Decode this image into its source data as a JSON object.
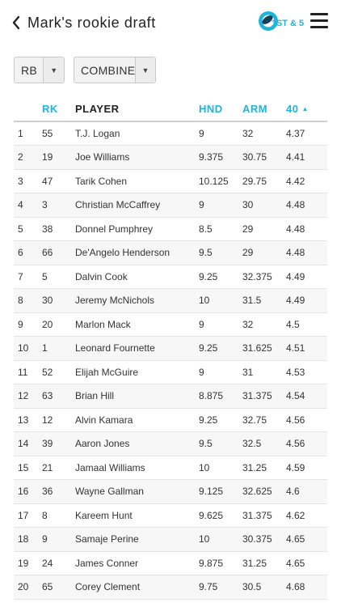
{
  "header": {
    "title": "Mark's rookie draft",
    "logo_text": "1ST & 5",
    "colors": {
      "accent": "#1fb4dc",
      "logo_dark": "#1a3d5c"
    }
  },
  "filters": {
    "position": {
      "value": "RB"
    },
    "stat": {
      "value": "COMBINE"
    }
  },
  "table": {
    "columns": {
      "index": "",
      "rank": "RK",
      "player": "PLAYER",
      "hand": "HND",
      "arm": "ARM",
      "forty": "40"
    },
    "sort_column": "forty",
    "sort_direction": "ascending",
    "rows": [
      {
        "index": "1",
        "rank": "55",
        "player": "T.J. Logan",
        "hand": "9",
        "arm": "32",
        "forty": "4.37"
      },
      {
        "index": "2",
        "rank": "19",
        "player": "Joe Williams",
        "hand": "9.375",
        "arm": "30.75",
        "forty": "4.41"
      },
      {
        "index": "3",
        "rank": "47",
        "player": "Tarik Cohen",
        "hand": "10.125",
        "arm": "29.75",
        "forty": "4.42"
      },
      {
        "index": "4",
        "rank": "3",
        "player": "Christian McCaffrey",
        "hand": "9",
        "arm": "30",
        "forty": "4.48"
      },
      {
        "index": "5",
        "rank": "38",
        "player": "Donnel Pumphrey",
        "hand": "8.5",
        "arm": "29",
        "forty": "4.48"
      },
      {
        "index": "6",
        "rank": "66",
        "player": "De'Angelo Henderson",
        "hand": "9.5",
        "arm": "29",
        "forty": "4.48"
      },
      {
        "index": "7",
        "rank": "5",
        "player": "Dalvin Cook",
        "hand": "9.25",
        "arm": "32.375",
        "forty": "4.49"
      },
      {
        "index": "8",
        "rank": "30",
        "player": "Jeremy McNichols",
        "hand": "10",
        "arm": "31.5",
        "forty": "4.49"
      },
      {
        "index": "9",
        "rank": "20",
        "player": "Marlon Mack",
        "hand": "9",
        "arm": "32",
        "forty": "4.5"
      },
      {
        "index": "10",
        "rank": "1",
        "player": "Leonard Fournette",
        "hand": "9.25",
        "arm": "31.625",
        "forty": "4.51"
      },
      {
        "index": "11",
        "rank": "52",
        "player": "Elijah McGuire",
        "hand": "9",
        "arm": "31",
        "forty": "4.53"
      },
      {
        "index": "12",
        "rank": "63",
        "player": "Brian Hill",
        "hand": "8.875",
        "arm": "31.375",
        "forty": "4.54"
      },
      {
        "index": "13",
        "rank": "12",
        "player": "Alvin Kamara",
        "hand": "9.25",
        "arm": "32.75",
        "forty": "4.56"
      },
      {
        "index": "14",
        "rank": "39",
        "player": "Aaron Jones",
        "hand": "9.5",
        "arm": "32.5",
        "forty": "4.56"
      },
      {
        "index": "15",
        "rank": "21",
        "player": "Jamaal Williams",
        "hand": "10",
        "arm": "31.25",
        "forty": "4.59"
      },
      {
        "index": "16",
        "rank": "36",
        "player": "Wayne Gallman",
        "hand": "9.125",
        "arm": "32.625",
        "forty": "4.6"
      },
      {
        "index": "17",
        "rank": "8",
        "player": "Kareem Hunt",
        "hand": "9.625",
        "arm": "31.375",
        "forty": "4.62"
      },
      {
        "index": "18",
        "rank": "9",
        "player": "Samaje Perine",
        "hand": "10",
        "arm": "30.375",
        "forty": "4.65"
      },
      {
        "index": "19",
        "rank": "24",
        "player": "James Conner",
        "hand": "9.875",
        "arm": "31.25",
        "forty": "4.65"
      },
      {
        "index": "20",
        "rank": "65",
        "player": "Corey Clement",
        "hand": "9.75",
        "arm": "30.5",
        "forty": "4.68"
      }
    ]
  }
}
